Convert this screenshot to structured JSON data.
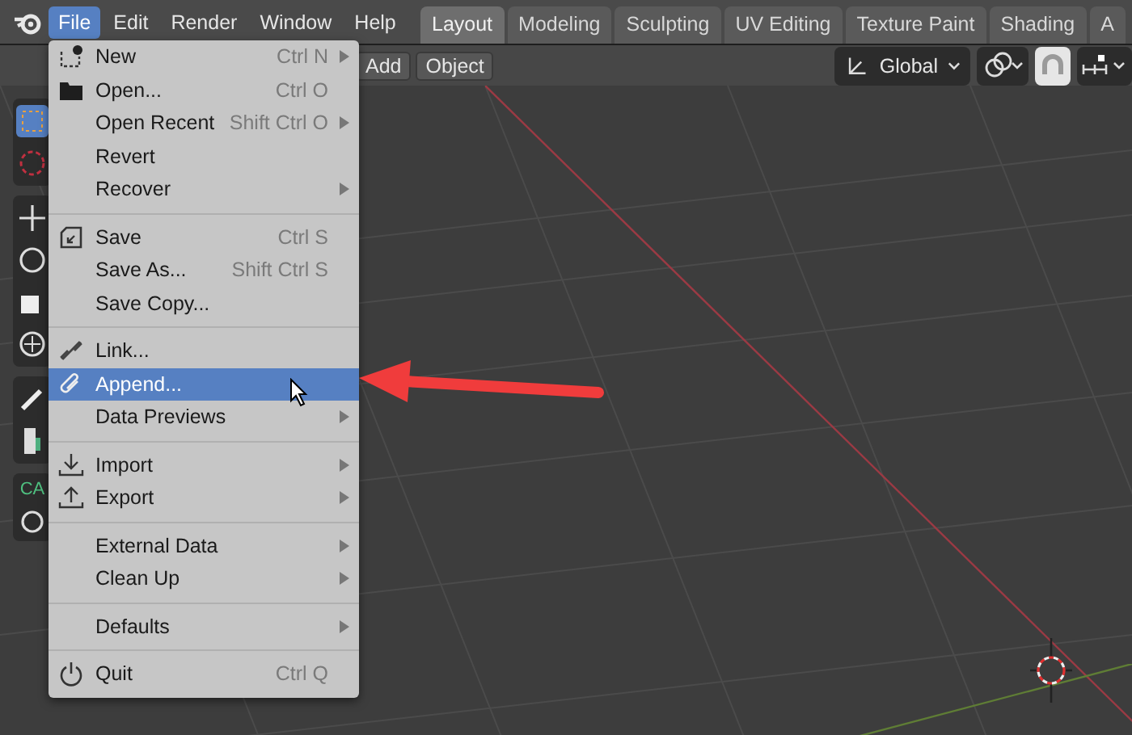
{
  "menubar": {
    "items": [
      {
        "label": "File",
        "selected": true
      },
      {
        "label": "Edit",
        "selected": false
      },
      {
        "label": "Render",
        "selected": false
      },
      {
        "label": "Window",
        "selected": false
      },
      {
        "label": "Help",
        "selected": false
      }
    ]
  },
  "workspace_tabs": [
    {
      "label": "Layout",
      "selected": true
    },
    {
      "label": "Modeling",
      "selected": false
    },
    {
      "label": "Sculpting",
      "selected": false
    },
    {
      "label": "UV Editing",
      "selected": false
    },
    {
      "label": "Texture Paint",
      "selected": false
    },
    {
      "label": "Shading",
      "selected": false
    },
    {
      "label": "A",
      "selected": false
    }
  ],
  "header": {
    "buttons": [
      "Add",
      "Object"
    ],
    "orientation": "Global",
    "snap_on": true
  },
  "toolbar": {
    "label": "CA"
  },
  "file_menu": {
    "sections": [
      [
        {
          "label": "New",
          "shortcut": "Ctrl N",
          "submenu": true,
          "selected": false
        },
        {
          "label": "Open...",
          "shortcut": "Ctrl O",
          "submenu": false,
          "selected": false
        },
        {
          "label": "Open Recent",
          "shortcut": "Shift Ctrl O",
          "submenu": true,
          "selected": false
        },
        {
          "label": "Revert",
          "submenu": false,
          "selected": false
        },
        {
          "label": "Recover",
          "submenu": true,
          "selected": false
        }
      ],
      [
        {
          "label": "Save",
          "shortcut": "Ctrl S",
          "submenu": false,
          "selected": false
        },
        {
          "label": "Save As...",
          "shortcut": "Shift Ctrl S",
          "submenu": false,
          "selected": false
        },
        {
          "label": "Save Copy...",
          "submenu": false,
          "selected": false
        }
      ],
      [
        {
          "label": "Link...",
          "submenu": false,
          "selected": false
        },
        {
          "label": "Append...",
          "submenu": false,
          "selected": true
        },
        {
          "label": "Data Previews",
          "submenu": true,
          "selected": false
        }
      ],
      [
        {
          "label": "Import",
          "submenu": true,
          "selected": false
        },
        {
          "label": "Export",
          "submenu": true,
          "selected": false
        }
      ],
      [
        {
          "label": "External Data",
          "submenu": true,
          "selected": false
        },
        {
          "label": "Clean Up",
          "submenu": true,
          "selected": false
        }
      ],
      [
        {
          "label": "Defaults",
          "submenu": true,
          "selected": false
        }
      ],
      [
        {
          "label": "Quit",
          "shortcut": "Ctrl Q",
          "submenu": false,
          "selected": false
        }
      ]
    ]
  }
}
